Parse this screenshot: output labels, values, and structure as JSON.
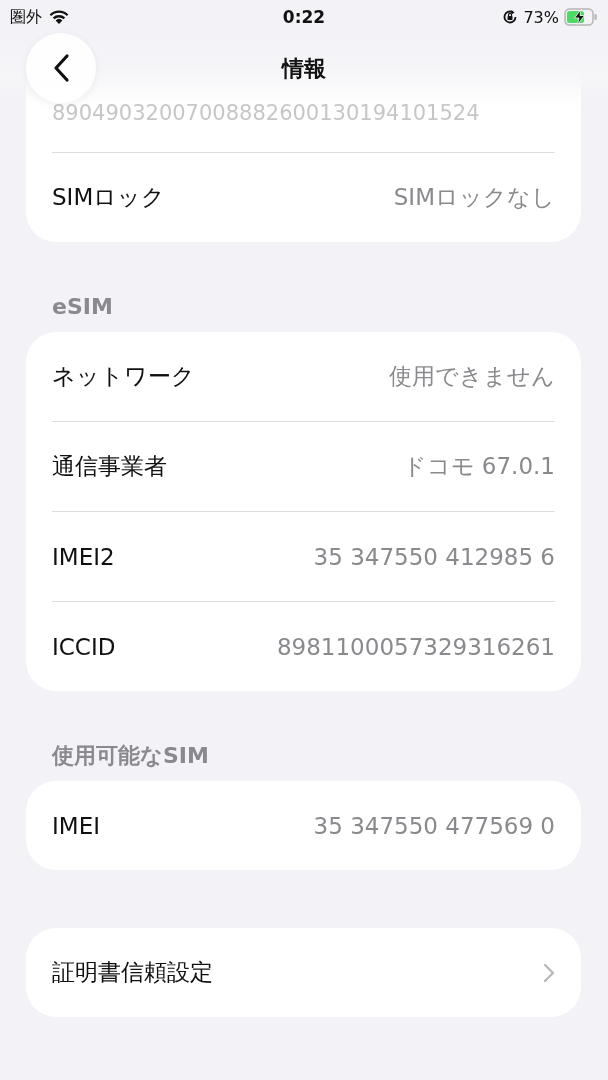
{
  "status_bar": {
    "carrier": "圏外",
    "time": "0:22",
    "battery": "73%",
    "charging": true
  },
  "nav": {
    "title": "情報"
  },
  "sections": [
    {
      "rows": [
        {
          "kind": "faded",
          "value": "89049032007008882600130194101524"
        },
        {
          "kind": "value",
          "label": "SIMロック",
          "value": "SIMロックなし"
        }
      ]
    },
    {
      "header": "eSIM",
      "rows": [
        {
          "kind": "value",
          "label": "ネットワーク",
          "value": "使用できません"
        },
        {
          "kind": "value",
          "label": "通信事業者",
          "value": "ドコモ 67.0.1"
        },
        {
          "kind": "value",
          "label": "IMEI2",
          "value": "35 347550 412985 6"
        },
        {
          "kind": "value",
          "label": "ICCID",
          "value": "8981100057329316261"
        }
      ]
    },
    {
      "header": "使用可能なSIM",
      "rows": [
        {
          "kind": "value",
          "label": "IMEI",
          "value": "35 347550 477569 0"
        }
      ]
    },
    {
      "rows": [
        {
          "kind": "link",
          "label": "証明書信頼設定"
        }
      ]
    }
  ]
}
